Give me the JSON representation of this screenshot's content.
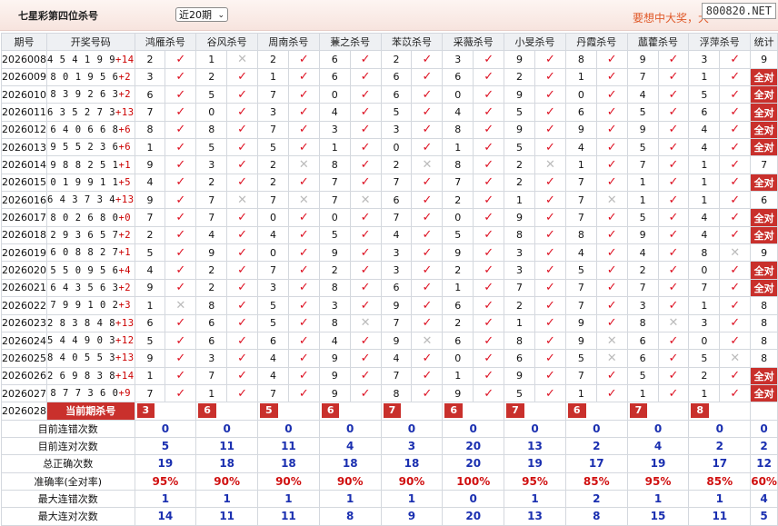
{
  "header": {
    "title": "七星彩第四位杀号",
    "period_select": "近20期",
    "marquee": "要想中大奖，大",
    "watermark": "800820.NET"
  },
  "columns": [
    "期号",
    "开奖号码",
    "鸿雁杀号",
    "谷风杀号",
    "周南杀号",
    "蒹之杀号",
    "苯苡杀号",
    "采薇杀号",
    "小旻杀号",
    "丹霞杀号",
    "蓏藿杀号",
    "浮萍杀号",
    "统计"
  ],
  "rows": [
    {
      "p": "2026008",
      "d": "4541 99",
      "n": "+14",
      "k": [
        [
          "2",
          "ok"
        ],
        [
          "1",
          "no"
        ],
        [
          "2",
          "ok"
        ],
        [
          "6",
          "ok"
        ],
        [
          "2",
          "ok"
        ],
        [
          "3",
          "ok"
        ],
        [
          "9",
          "ok"
        ],
        [
          "8",
          "ok"
        ],
        [
          "9",
          "ok"
        ],
        [
          "3",
          "ok"
        ]
      ],
      "s": "9"
    },
    {
      "p": "2026009",
      "d": "801956",
      "n": "+2",
      "k": [
        [
          "3",
          "ok"
        ],
        [
          "2",
          "ok"
        ],
        [
          "1",
          "ok"
        ],
        [
          "6",
          "ok"
        ],
        [
          "6",
          "ok"
        ],
        [
          "6",
          "ok"
        ],
        [
          "2",
          "ok"
        ],
        [
          "1",
          "ok"
        ],
        [
          "7",
          "ok"
        ],
        [
          "1",
          "ok"
        ]
      ],
      "s": "全对"
    },
    {
      "p": "2026010",
      "d": "839263",
      "n": "+2",
      "k": [
        [
          "6",
          "ok"
        ],
        [
          "5",
          "ok"
        ],
        [
          "7",
          "ok"
        ],
        [
          "0",
          "ok"
        ],
        [
          "6",
          "ok"
        ],
        [
          "0",
          "ok"
        ],
        [
          "9",
          "ok"
        ],
        [
          "0",
          "ok"
        ],
        [
          "4",
          "ok"
        ],
        [
          "5",
          "ok"
        ]
      ],
      "s": "全对"
    },
    {
      "p": "2026011",
      "d": "635273",
      "n": "+13",
      "k": [
        [
          "7",
          "ok"
        ],
        [
          "0",
          "ok"
        ],
        [
          "3",
          "ok"
        ],
        [
          "4",
          "ok"
        ],
        [
          "5",
          "ok"
        ],
        [
          "4",
          "ok"
        ],
        [
          "5",
          "ok"
        ],
        [
          "6",
          "ok"
        ],
        [
          "5",
          "ok"
        ],
        [
          "6",
          "ok"
        ]
      ],
      "s": "全对"
    },
    {
      "p": "2026012",
      "d": "640668",
      "n": "+6",
      "k": [
        [
          "8",
          "ok"
        ],
        [
          "8",
          "ok"
        ],
        [
          "7",
          "ok"
        ],
        [
          "3",
          "ok"
        ],
        [
          "3",
          "ok"
        ],
        [
          "8",
          "ok"
        ],
        [
          "9",
          "ok"
        ],
        [
          "9",
          "ok"
        ],
        [
          "9",
          "ok"
        ],
        [
          "4",
          "ok"
        ]
      ],
      "s": "全对"
    },
    {
      "p": "2026013",
      "d": "955236",
      "n": "+6",
      "k": [
        [
          "1",
          "ok"
        ],
        [
          "5",
          "ok"
        ],
        [
          "5",
          "ok"
        ],
        [
          "1",
          "ok"
        ],
        [
          "0",
          "ok"
        ],
        [
          "1",
          "ok"
        ],
        [
          "5",
          "ok"
        ],
        [
          "4",
          "ok"
        ],
        [
          "5",
          "ok"
        ],
        [
          "4",
          "ok"
        ]
      ],
      "s": "全对"
    },
    {
      "p": "2026014",
      "d": "988251",
      "n": "+1",
      "k": [
        [
          "9",
          "ok"
        ],
        [
          "3",
          "ok"
        ],
        [
          "2",
          "no"
        ],
        [
          "8",
          "ok"
        ],
        [
          "2",
          "no"
        ],
        [
          "8",
          "ok"
        ],
        [
          "2",
          "no"
        ],
        [
          "1",
          "ok"
        ],
        [
          "7",
          "ok"
        ],
        [
          "1",
          "ok"
        ]
      ],
      "s": "7"
    },
    {
      "p": "2026015",
      "d": "019911",
      "n": "+5",
      "k": [
        [
          "4",
          "ok"
        ],
        [
          "2",
          "ok"
        ],
        [
          "2",
          "ok"
        ],
        [
          "7",
          "ok"
        ],
        [
          "7",
          "ok"
        ],
        [
          "7",
          "ok"
        ],
        [
          "2",
          "ok"
        ],
        [
          "7",
          "ok"
        ],
        [
          "1",
          "ok"
        ],
        [
          "1",
          "ok"
        ]
      ],
      "s": "全对"
    },
    {
      "p": "2026016",
      "d": "643734",
      "n": "+13",
      "k": [
        [
          "9",
          "ok"
        ],
        [
          "7",
          "no"
        ],
        [
          "7",
          "no"
        ],
        [
          "7",
          "no"
        ],
        [
          "6",
          "ok"
        ],
        [
          "2",
          "ok"
        ],
        [
          "1",
          "ok"
        ],
        [
          "7",
          "no"
        ],
        [
          "1",
          "ok"
        ],
        [
          "1",
          "ok"
        ]
      ],
      "s": "6"
    },
    {
      "p": "2026017",
      "d": "802680",
      "n": "+0",
      "k": [
        [
          "7",
          "ok"
        ],
        [
          "7",
          "ok"
        ],
        [
          "0",
          "ok"
        ],
        [
          "0",
          "ok"
        ],
        [
          "7",
          "ok"
        ],
        [
          "0",
          "ok"
        ],
        [
          "9",
          "ok"
        ],
        [
          "7",
          "ok"
        ],
        [
          "5",
          "ok"
        ],
        [
          "4",
          "ok"
        ]
      ],
      "s": "全对"
    },
    {
      "p": "2026018",
      "d": "293657",
      "n": "+2",
      "k": [
        [
          "2",
          "ok"
        ],
        [
          "4",
          "ok"
        ],
        [
          "4",
          "ok"
        ],
        [
          "5",
          "ok"
        ],
        [
          "4",
          "ok"
        ],
        [
          "5",
          "ok"
        ],
        [
          "8",
          "ok"
        ],
        [
          "8",
          "ok"
        ],
        [
          "9",
          "ok"
        ],
        [
          "4",
          "ok"
        ]
      ],
      "s": "全对"
    },
    {
      "p": "2026019",
      "d": "608827",
      "n": "+1",
      "k": [
        [
          "5",
          "ok"
        ],
        [
          "9",
          "ok"
        ],
        [
          "0",
          "ok"
        ],
        [
          "9",
          "ok"
        ],
        [
          "3",
          "ok"
        ],
        [
          "9",
          "ok"
        ],
        [
          "3",
          "ok"
        ],
        [
          "4",
          "ok"
        ],
        [
          "4",
          "ok"
        ],
        [
          "8",
          "no"
        ]
      ],
      "s": "9"
    },
    {
      "p": "2026020",
      "d": "550956",
      "n": "+4",
      "k": [
        [
          "4",
          "ok"
        ],
        [
          "2",
          "ok"
        ],
        [
          "7",
          "ok"
        ],
        [
          "2",
          "ok"
        ],
        [
          "3",
          "ok"
        ],
        [
          "2",
          "ok"
        ],
        [
          "3",
          "ok"
        ],
        [
          "5",
          "ok"
        ],
        [
          "2",
          "ok"
        ],
        [
          "0",
          "ok"
        ]
      ],
      "s": "全对"
    },
    {
      "p": "2026021",
      "d": "643563",
      "n": "+2",
      "k": [
        [
          "9",
          "ok"
        ],
        [
          "2",
          "ok"
        ],
        [
          "3",
          "ok"
        ],
        [
          "8",
          "ok"
        ],
        [
          "6",
          "ok"
        ],
        [
          "1",
          "ok"
        ],
        [
          "7",
          "ok"
        ],
        [
          "7",
          "ok"
        ],
        [
          "7",
          "ok"
        ],
        [
          "7",
          "ok"
        ]
      ],
      "s": "全对"
    },
    {
      "p": "2026022",
      "d": "799102",
      "n": "+3",
      "k": [
        [
          "1",
          "no"
        ],
        [
          "8",
          "ok"
        ],
        [
          "5",
          "ok"
        ],
        [
          "3",
          "ok"
        ],
        [
          "9",
          "ok"
        ],
        [
          "6",
          "ok"
        ],
        [
          "2",
          "ok"
        ],
        [
          "7",
          "ok"
        ],
        [
          "3",
          "ok"
        ],
        [
          "1",
          "ok"
        ]
      ],
      "s": "8"
    },
    {
      "p": "2026023",
      "d": "283848",
      "n": "+13",
      "k": [
        [
          "6",
          "ok"
        ],
        [
          "6",
          "ok"
        ],
        [
          "5",
          "ok"
        ],
        [
          "8",
          "no"
        ],
        [
          "7",
          "ok"
        ],
        [
          "2",
          "ok"
        ],
        [
          "1",
          "ok"
        ],
        [
          "9",
          "ok"
        ],
        [
          "8",
          "no"
        ],
        [
          "3",
          "ok"
        ]
      ],
      "s": "8"
    },
    {
      "p": "2026024",
      "d": "544903",
      "n": "+12",
      "k": [
        [
          "5",
          "ok"
        ],
        [
          "6",
          "ok"
        ],
        [
          "6",
          "ok"
        ],
        [
          "4",
          "ok"
        ],
        [
          "9",
          "no"
        ],
        [
          "6",
          "ok"
        ],
        [
          "8",
          "ok"
        ],
        [
          "9",
          "no"
        ],
        [
          "6",
          "ok"
        ],
        [
          "0",
          "ok"
        ]
      ],
      "s": "8"
    },
    {
      "p": "2026025",
      "d": "840553",
      "n": "+13",
      "k": [
        [
          "9",
          "ok"
        ],
        [
          "3",
          "ok"
        ],
        [
          "4",
          "ok"
        ],
        [
          "9",
          "ok"
        ],
        [
          "4",
          "ok"
        ],
        [
          "0",
          "ok"
        ],
        [
          "6",
          "ok"
        ],
        [
          "5",
          "no"
        ],
        [
          "6",
          "ok"
        ],
        [
          "5",
          "no"
        ]
      ],
      "s": "8"
    },
    {
      "p": "2026026",
      "d": "269838",
      "n": "+14",
      "k": [
        [
          "1",
          "ok"
        ],
        [
          "7",
          "ok"
        ],
        [
          "4",
          "ok"
        ],
        [
          "9",
          "ok"
        ],
        [
          "7",
          "ok"
        ],
        [
          "1",
          "ok"
        ],
        [
          "9",
          "ok"
        ],
        [
          "7",
          "ok"
        ],
        [
          "5",
          "ok"
        ],
        [
          "2",
          "ok"
        ]
      ],
      "s": "全对"
    },
    {
      "p": "2026027",
      "d": "877360",
      "n": "+9",
      "k": [
        [
          "7",
          "ok"
        ],
        [
          "1",
          "ok"
        ],
        [
          "7",
          "ok"
        ],
        [
          "9",
          "ok"
        ],
        [
          "8",
          "ok"
        ],
        [
          "9",
          "ok"
        ],
        [
          "5",
          "ok"
        ],
        [
          "1",
          "ok"
        ],
        [
          "1",
          "ok"
        ],
        [
          "1",
          "ok"
        ]
      ],
      "s": "全对"
    }
  ],
  "current": {
    "period": "2026028",
    "label": "当前期杀号",
    "preds": [
      "3",
      "6",
      "5",
      "6",
      "7",
      "6",
      "7",
      "6",
      "7",
      "8"
    ]
  },
  "summary": [
    {
      "label": "目前连错次数",
      "vals": [
        "0",
        "0",
        "0",
        "0",
        "0",
        "0",
        "0",
        "0",
        "0",
        "0",
        "0"
      ],
      "pct": false
    },
    {
      "label": "目前连对次数",
      "vals": [
        "5",
        "11",
        "11",
        "4",
        "3",
        "20",
        "13",
        "2",
        "4",
        "2",
        "2"
      ],
      "pct": false
    },
    {
      "label": "总正确次数",
      "vals": [
        "19",
        "18",
        "18",
        "18",
        "18",
        "20",
        "19",
        "17",
        "19",
        "17",
        "12"
      ],
      "pct": false
    },
    {
      "label": "准确率(全对率)",
      "vals": [
        "95%",
        "90%",
        "90%",
        "90%",
        "90%",
        "100%",
        "95%",
        "85%",
        "95%",
        "85%",
        "60%"
      ],
      "pct": true
    },
    {
      "label": "最大连错次数",
      "vals": [
        "1",
        "1",
        "1",
        "1",
        "1",
        "0",
        "1",
        "2",
        "1",
        "1",
        "4"
      ],
      "pct": false
    },
    {
      "label": "最大连对次数",
      "vals": [
        "14",
        "11",
        "11",
        "8",
        "9",
        "20",
        "13",
        "8",
        "15",
        "11",
        "5"
      ],
      "pct": false
    }
  ]
}
